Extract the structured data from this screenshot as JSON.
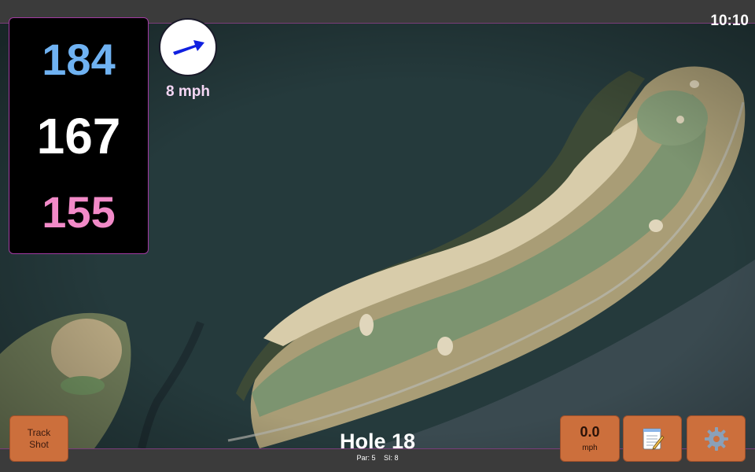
{
  "status": {
    "clock": "10:10"
  },
  "distances": {
    "back": "184",
    "middle": "167",
    "front": "155"
  },
  "wind": {
    "speed": "8 mph",
    "icon": "arrow-icon"
  },
  "hole": {
    "title": "Hole 18",
    "par": "Par: 5",
    "si": "SI: 8"
  },
  "buttons": {
    "track_shot_line1": "Track",
    "track_shot_line2": "Shot",
    "speed_value": "0.0",
    "speed_unit": "mph",
    "notes_icon": "notepad-icon",
    "settings_icon": "gear-icon"
  },
  "colors": {
    "accent_border": "#a23aa2",
    "button_bg": "#cc6f3c",
    "back_distance": "#6fb2f2",
    "middle_distance": "#ffffff",
    "front_distance": "#f28ac8",
    "wind_text": "#f5d7f5"
  }
}
